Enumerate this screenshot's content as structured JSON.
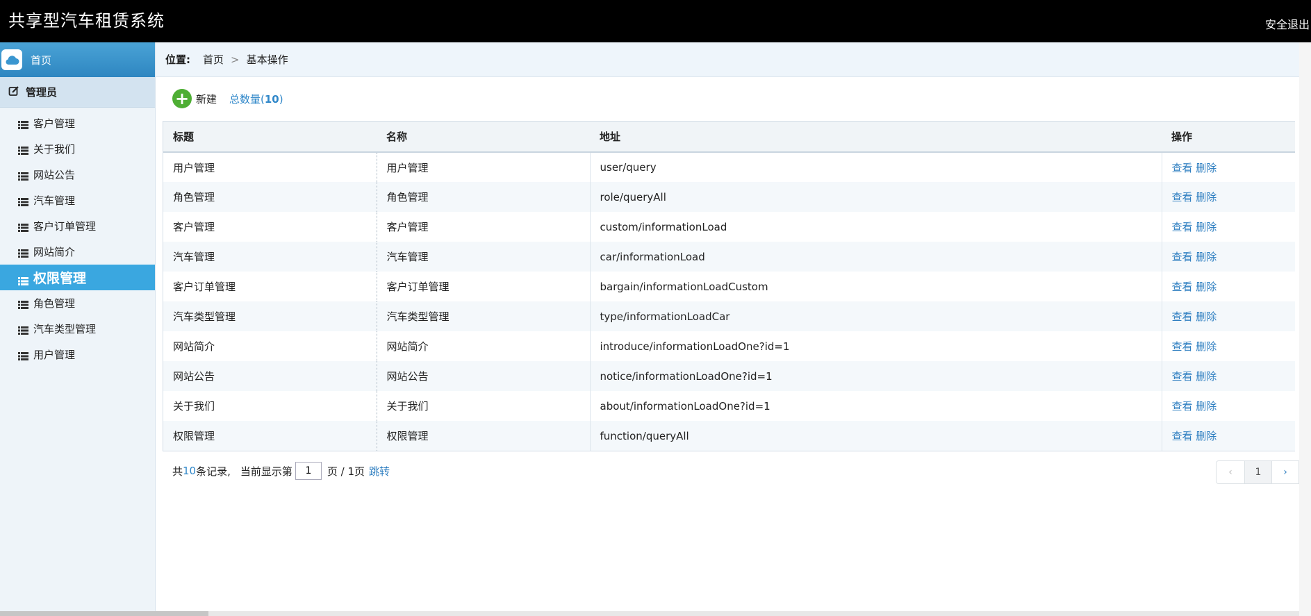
{
  "header": {
    "title": "共享型汽车租赁系统",
    "logout_label": "安全退出"
  },
  "sidebar": {
    "home_label": "首页",
    "group_label": "管理员",
    "items": [
      {
        "label": "客户管理"
      },
      {
        "label": "关于我们"
      },
      {
        "label": "网站公告"
      },
      {
        "label": "汽车管理"
      },
      {
        "label": "客户订单管理"
      },
      {
        "label": "网站简介"
      },
      {
        "label": "权限管理"
      },
      {
        "label": "角色管理"
      },
      {
        "label": "汽车类型管理"
      },
      {
        "label": "用户管理"
      }
    ]
  },
  "breadcrumb": {
    "prefix": "位置:",
    "home": "首页",
    "separator": ">",
    "current": "基本操作"
  },
  "toolbar": {
    "new_label": "新建",
    "total_prefix": "总数量(",
    "total_count": "10",
    "total_suffix": ")"
  },
  "table": {
    "headers": [
      "标题",
      "名称",
      "地址",
      "操作"
    ],
    "view_label": "查看",
    "delete_label": "删除",
    "rows": [
      {
        "title": "用户管理",
        "name": "用户管理",
        "path": "user/query"
      },
      {
        "title": "角色管理",
        "name": "角色管理",
        "path": "role/queryAll"
      },
      {
        "title": "客户管理",
        "name": "客户管理",
        "path": "custom/informationLoad"
      },
      {
        "title": "汽车管理",
        "name": "汽车管理",
        "path": "car/informationLoad"
      },
      {
        "title": "客户订单管理",
        "name": "客户订单管理",
        "path": "bargain/informationLoadCustom"
      },
      {
        "title": "汽车类型管理",
        "name": "汽车类型管理",
        "path": "type/informationLoadCar"
      },
      {
        "title": "网站简介",
        "name": "网站简介",
        "path": "introduce/informationLoadOne?id=1"
      },
      {
        "title": "网站公告",
        "name": "网站公告",
        "path": "notice/informationLoadOne?id=1"
      },
      {
        "title": "关于我们",
        "name": "关于我们",
        "path": "about/informationLoadOne?id=1"
      },
      {
        "title": "权限管理",
        "name": "权限管理",
        "path": "function/queryAll"
      }
    ]
  },
  "pager": {
    "prefix": "共",
    "record_count": "10",
    "records_suffix": "条记录,",
    "current_prefix": "当前显示第",
    "current_page": "1",
    "page_suffix": "页 / 1页",
    "jump_label": "跳转",
    "page_number": "1",
    "prev_icon": "‹",
    "next_icon": "›"
  },
  "colors": {
    "header_bg": "#000000",
    "sidebar_bg": "#eef4f9",
    "active_item": "#3aa7e0",
    "link": "#2f7fc1",
    "add_green": "#4eae34"
  },
  "icons": {
    "home": "cloud-icon",
    "group": "edit-icon",
    "item": "list-icon",
    "new": "plus-circle-icon"
  }
}
